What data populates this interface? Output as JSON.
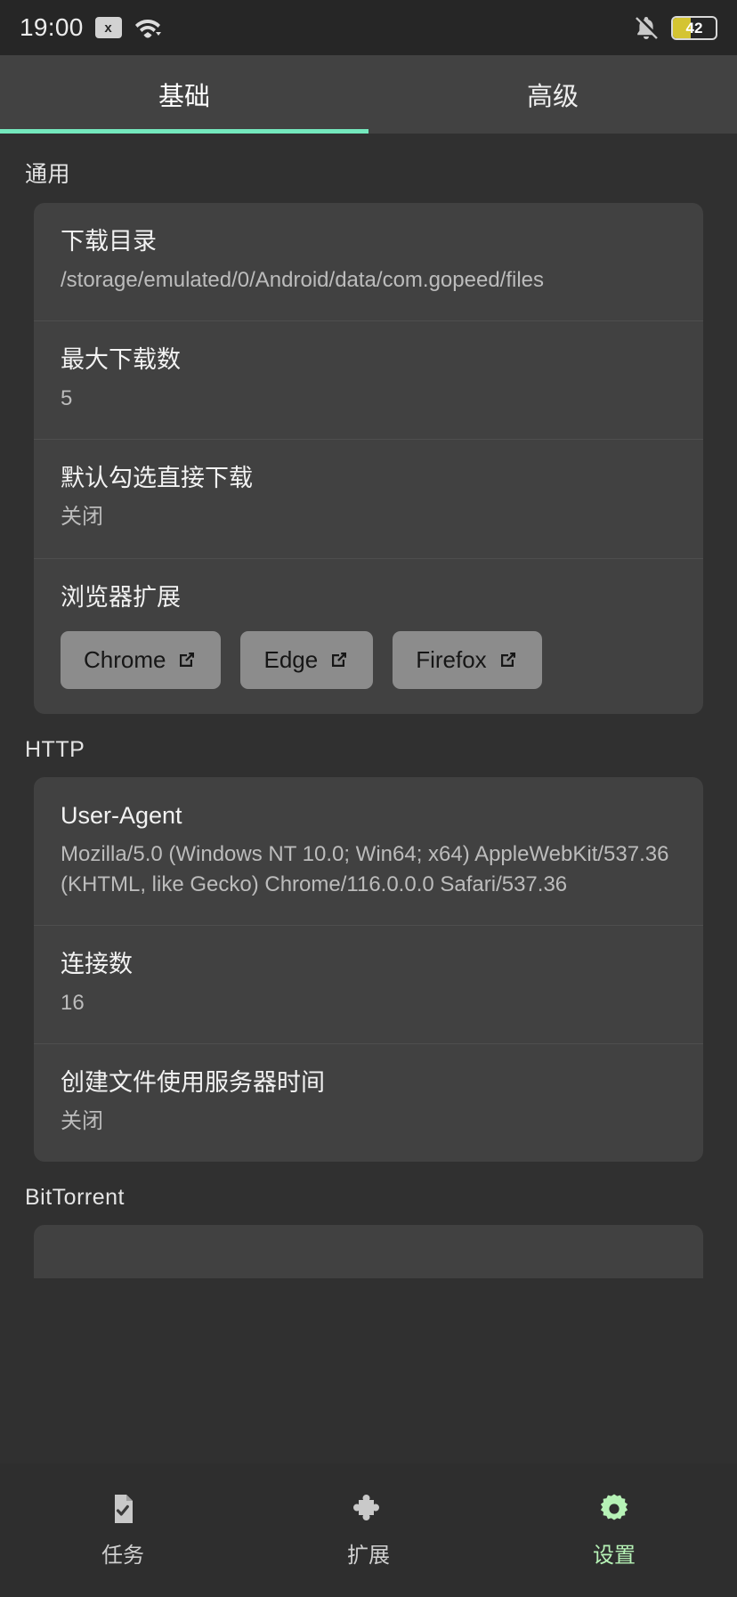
{
  "statusbar": {
    "time": "19:00",
    "sim_label": "x",
    "battery_level": "42",
    "icons": {
      "sim": "sim-card-icon",
      "wifi": "wifi-icon",
      "mute": "bell-mute-icon",
      "battery": "battery-icon"
    }
  },
  "tabs": [
    {
      "label": "基础",
      "active": true
    },
    {
      "label": "高级",
      "active": false
    }
  ],
  "sections": [
    {
      "title": "通用",
      "rows": [
        {
          "title": "下载目录",
          "value": "/storage/emulated/0/Android/data/com.gopeed/files"
        },
        {
          "title": "最大下载数",
          "value": "5"
        },
        {
          "title": "默认勾选直接下载",
          "value": "关闭"
        },
        {
          "title": "浏览器扩展",
          "value": ""
        }
      ],
      "browser_buttons": [
        {
          "label": "Chrome",
          "icon": "external-link-icon"
        },
        {
          "label": "Edge",
          "icon": "external-link-icon"
        },
        {
          "label": "Firefox",
          "icon": "external-link-icon"
        }
      ]
    },
    {
      "title": "HTTP",
      "rows": [
        {
          "title": "User-Agent",
          "value": "Mozilla/5.0 (Windows NT 10.0; Win64; x64) AppleWebKit/537.36 (KHTML, like Gecko) Chrome/116.0.0.0 Safari/537.36"
        },
        {
          "title": "连接数",
          "value": "16"
        },
        {
          "title": "创建文件使用服务器时间",
          "value": "关闭"
        }
      ]
    },
    {
      "title": "BitTorrent",
      "rows": []
    }
  ],
  "bottomnav": [
    {
      "label": "任务",
      "icon": "file-check-icon",
      "active": false
    },
    {
      "label": "扩展",
      "icon": "puzzle-piece-icon",
      "active": false
    },
    {
      "label": "设置",
      "icon": "gear-icon",
      "active": true
    }
  ],
  "colors": {
    "accent": "#74e8bd",
    "nav_active": "#b6f2b6",
    "battery_fill": "#d4c432",
    "card_bg": "#414141",
    "page_bg": "#303030"
  }
}
